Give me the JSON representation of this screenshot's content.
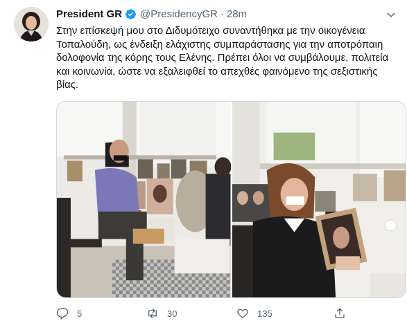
{
  "tweet": {
    "author_name": "President GR",
    "handle": "@PresidencyGR",
    "separator": "·",
    "time": "28m",
    "text": "Στην επίσκεψή μου στο Διδυμότειχο συναντήθηκα με την οικογένεια Τοπαλούδη, ως ένδειξη ελάχιστης συμπαράστασης για την αποτρόπαιη δολοφονία της κόρης τους Ελένης. Πρέπει όλοι να συμβάλουμε, πολιτεία και κοινωνία, ώστε να εξαλειφθεί το απεχθές φαινόμενο της σεξιστικής βίας.",
    "verified_color": "#1d9bf0"
  },
  "actions": {
    "reply_count": "5",
    "retweet_count": "30",
    "like_count": "135"
  },
  "icons": {
    "verified": "verified-badge-icon",
    "more": "chevron-down-icon",
    "reply": "reply-icon",
    "retweet": "retweet-icon",
    "like": "heart-icon",
    "share": "share-icon"
  }
}
